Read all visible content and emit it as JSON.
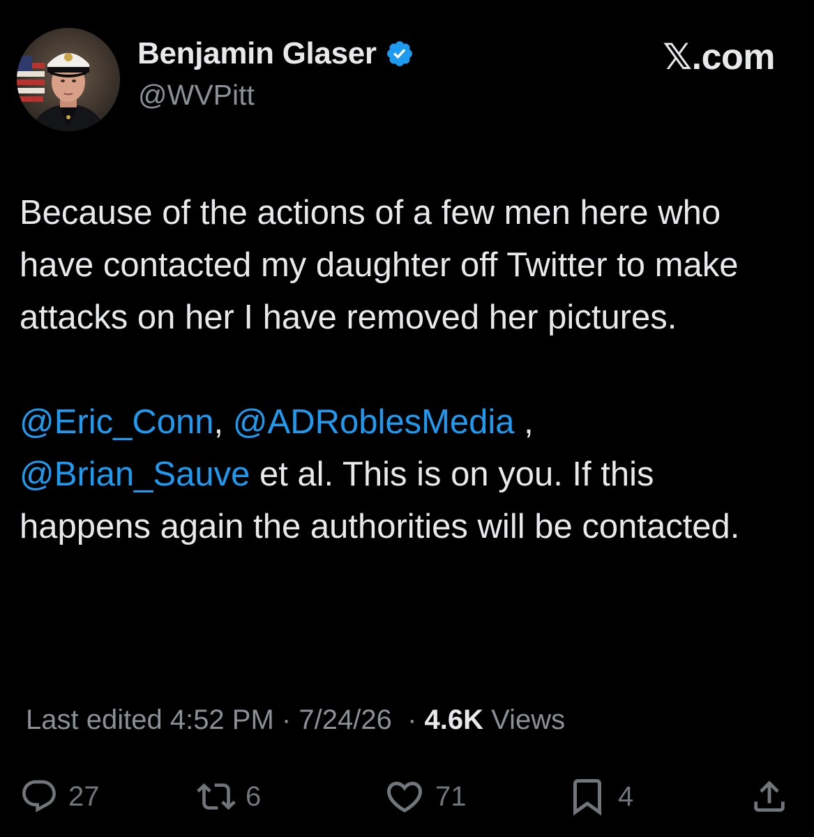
{
  "author": {
    "display_name": "Benjamin Glaser",
    "handle": "@WVPitt",
    "verified": true,
    "avatar_icon": "marine-portrait-avatar"
  },
  "brand": "𝕏.com",
  "tweet": {
    "paragraph1": "Because of the actions of a few men here who have contacted my daughter off Twitter to make attacks on her I have removed her pictures.",
    "mention1": "@Eric_Conn",
    "sep1": ", ",
    "mention2": "@ADRoblesMedia",
    "sep2": " , ",
    "mention3": "@Brian_Sauve",
    "rest": " et al. This is on you. If this happens again the authorities will be contacted."
  },
  "meta": {
    "edited_label": "Last edited",
    "time": "4:52 PM",
    "date": "7/24/26",
    "views_count": "4.6K",
    "views_label": "Views"
  },
  "actions": {
    "reply_count": "27",
    "retweet_count": "6",
    "like_count": "71",
    "bookmark_count": "4"
  },
  "colors": {
    "background": "#000000",
    "text": "#e7e9ea",
    "muted": "#8b9096",
    "link": "#1d9bf0",
    "verified": "#1d9bf0"
  }
}
